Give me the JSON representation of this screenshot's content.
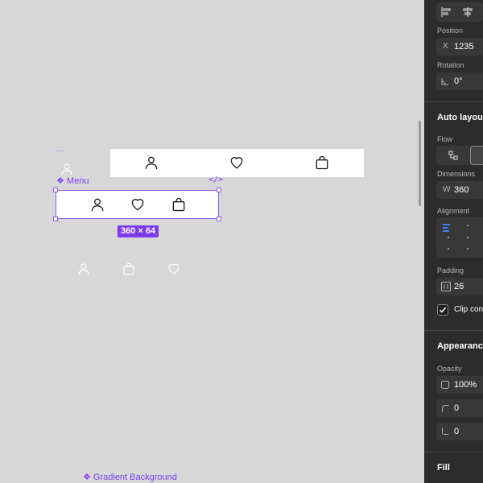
{
  "canvas": {
    "dots_label": "...",
    "menu_component_label": "❖ Menu",
    "code_icon_glyph": "</>",
    "size_badge": "360 × 64",
    "gradient_component_label": "❖ Gradient Background",
    "accent_color": "#7c3aed"
  },
  "panel": {
    "position_label": "Position",
    "x_prefix": "X",
    "x_value": "1235",
    "rotation_label": "Rotation",
    "rotation_value": "0°",
    "auto_layout_title": "Auto layout",
    "flow_label": "Flow",
    "dimensions_label": "Dimensions",
    "w_prefix": "W",
    "w_value": "360",
    "alignment_label": "Alignment",
    "padding_label": "Padding",
    "padding_value": "26",
    "clip_content_label": "Clip content",
    "appearance_title": "Appearance",
    "opacity_label": "Opacity",
    "opacity_value": "100%",
    "corner_radius_value": "0",
    "corner_smoothing_value": "0",
    "fill_title": "Fill"
  }
}
